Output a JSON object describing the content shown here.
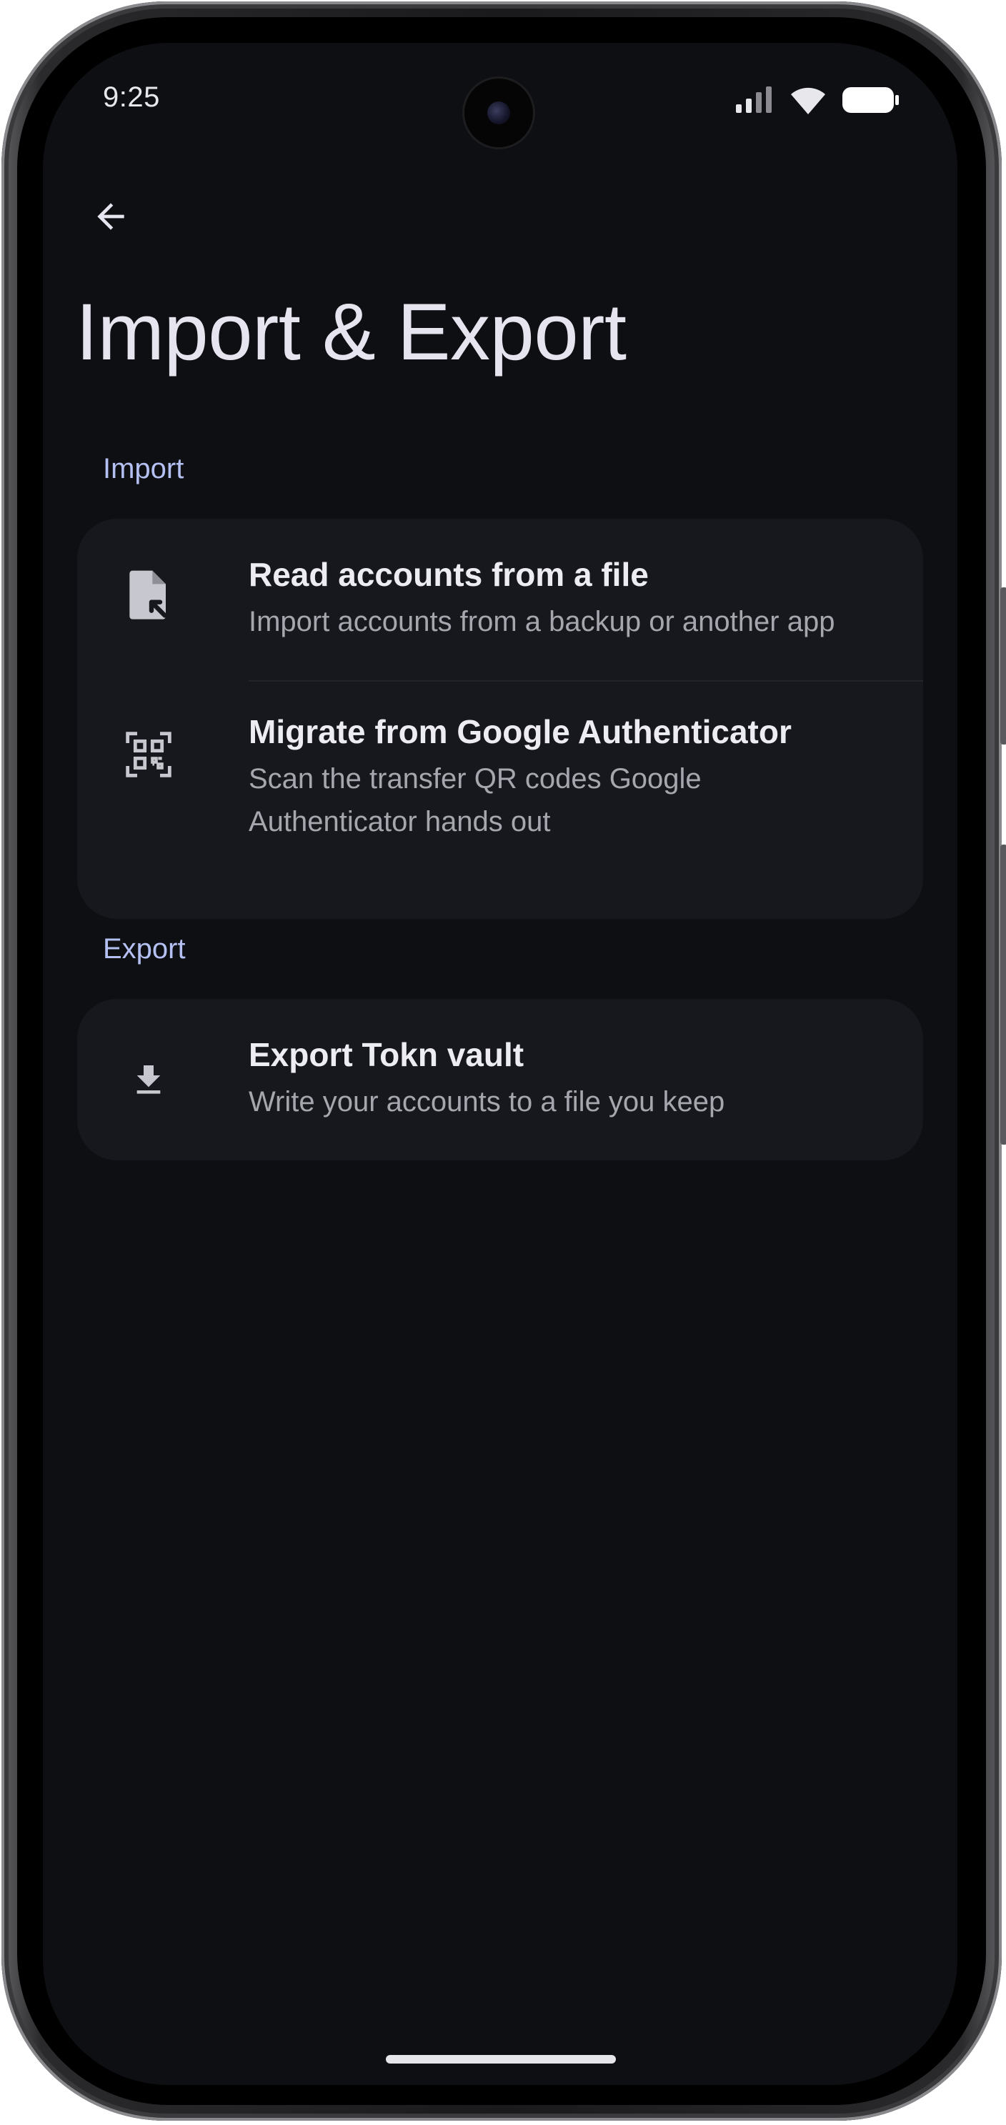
{
  "status_bar": {
    "time": "9:25"
  },
  "header": {
    "title": "Import & Export"
  },
  "sections": {
    "import": {
      "label": "Import",
      "items": [
        {
          "icon": "file-import-icon",
          "title": "Read accounts from a file",
          "subtitle": "Import accounts from a backup or another app"
        },
        {
          "icon": "qr-scan-icon",
          "title": "Migrate from Google Authenticator",
          "subtitle": "Scan the transfer QR codes Google Authenticator hands out"
        }
      ]
    },
    "export": {
      "label": "Export",
      "items": [
        {
          "icon": "download-icon",
          "title": "Export Tokn vault",
          "subtitle": "Write your accounts to a file you keep"
        }
      ]
    }
  },
  "colors": {
    "background": "#0e0f13",
    "card": "#17181d",
    "accent": "#b4c0f2",
    "title_text": "#ececf2",
    "secondary_text": "#a5a6ae"
  }
}
